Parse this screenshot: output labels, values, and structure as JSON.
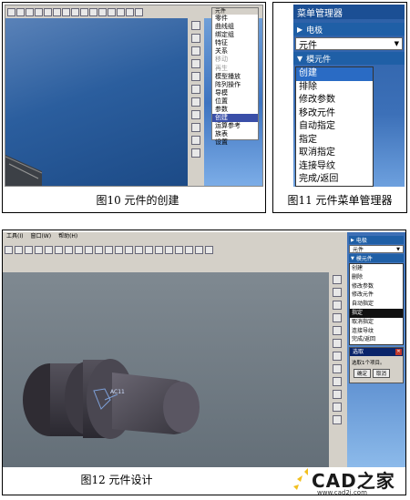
{
  "fig10": {
    "caption": "图10 元件的创建",
    "menu_title": "元件",
    "menu_items": [
      {
        "label": "零件",
        "state": "normal"
      },
      {
        "label": "曲线组",
        "state": "normal"
      },
      {
        "label": "绑定组",
        "state": "normal"
      },
      {
        "label": "特征",
        "state": "normal"
      },
      {
        "label": "关系",
        "state": "normal"
      },
      {
        "label": "移动",
        "state": "dim"
      },
      {
        "label": "再生",
        "state": "dim"
      },
      {
        "label": "模型播放",
        "state": "normal"
      },
      {
        "label": "阵列操作",
        "state": "normal"
      },
      {
        "label": "导模",
        "state": "normal"
      },
      {
        "label": "位置",
        "state": "normal"
      },
      {
        "label": "参数",
        "state": "normal"
      },
      {
        "label": "创建",
        "state": "selected"
      },
      {
        "label": "运算参考",
        "state": "normal"
      },
      {
        "label": "族表",
        "state": "normal"
      },
      {
        "label": "设置",
        "state": "normal"
      }
    ]
  },
  "fig11": {
    "caption": "图11 元件菜单管理器",
    "title": "菜单管理器",
    "section_label": "电极",
    "dropdown_value": "元件",
    "submenu_label": "模元件",
    "items": [
      {
        "label": "创建",
        "state": "selected"
      },
      {
        "label": "排除",
        "state": "normal"
      },
      {
        "label": "修改参数",
        "state": "normal"
      },
      {
        "label": "移改元件",
        "state": "normal"
      },
      {
        "label": "自动指定",
        "state": "normal"
      },
      {
        "label": "指定",
        "state": "normal"
      },
      {
        "label": "取消指定",
        "state": "normal"
      },
      {
        "label": "连接导纹",
        "state": "normal"
      },
      {
        "label": "完成/返回",
        "state": "normal"
      }
    ]
  },
  "fig12": {
    "caption": "图12 元件设计",
    "menubar": [
      "工具(I)",
      "窗口(W)",
      "帮助(H)"
    ],
    "menu_manager": {
      "section_label": "电极",
      "dropdown_value": "元件",
      "submenu_label": "模元件",
      "items": [
        {
          "label": "创建",
          "state": "normal"
        },
        {
          "label": "删除",
          "state": "normal"
        },
        {
          "label": "修改参数",
          "state": "normal"
        },
        {
          "label": "修改元件",
          "state": "normal"
        },
        {
          "label": "自动指定",
          "state": "normal"
        },
        {
          "label": "指定",
          "state": "selected"
        },
        {
          "label": "取消指定",
          "state": "normal"
        },
        {
          "label": "连接导纹",
          "state": "normal"
        },
        {
          "label": "完成/返回",
          "state": "normal"
        }
      ]
    },
    "select_dialog": {
      "title": "选取",
      "message": "选取1个项目。",
      "ok_label": "确定",
      "cancel_label": "取消"
    },
    "tag_label": "AC11"
  },
  "watermark": {
    "brand": "CAD之家",
    "url": "www.cad2j.com"
  },
  "colors": {
    "toolbar": "#d4d0c8",
    "menu_band": "#1f5fa6",
    "selection": "#2a6bc4",
    "viewport_gray": "#6e7a83",
    "viewport_blue": "#2f5f9c"
  }
}
